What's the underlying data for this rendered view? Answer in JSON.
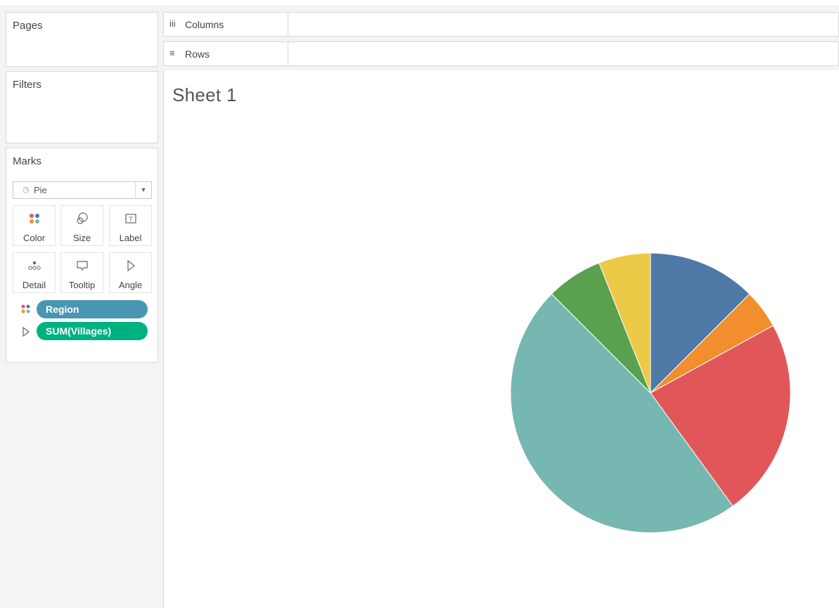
{
  "shelves": {
    "pages_label": "Pages",
    "filters_label": "Filters",
    "columns_label": "Columns",
    "rows_label": "Rows"
  },
  "marks": {
    "title": "Marks",
    "mark_type": "Pie",
    "buttons": [
      {
        "label": "Color",
        "icon": "color-dots-icon"
      },
      {
        "label": "Size",
        "icon": "size-icon"
      },
      {
        "label": "Label",
        "icon": "label-icon"
      },
      {
        "label": "Detail",
        "icon": "detail-dots-icon"
      },
      {
        "label": "Tooltip",
        "icon": "tooltip-icon"
      },
      {
        "label": "Angle",
        "icon": "angle-icon"
      }
    ],
    "pills": [
      {
        "label": "Region",
        "encoding": "color",
        "color": "#4996b2"
      },
      {
        "label": "SUM(Villages)",
        "encoding": "angle",
        "color": "#00b180"
      }
    ]
  },
  "view": {
    "sheet_title": "Sheet 1"
  },
  "chart_data": {
    "type": "pie",
    "title": "",
    "slices": [
      {
        "value": 12.5,
        "color": "#4e79a7"
      },
      {
        "value": 4.5,
        "color": "#f28e2b"
      },
      {
        "value": 23.0,
        "color": "#e15759"
      },
      {
        "value": 47.5,
        "color": "#76b7b2"
      },
      {
        "value": 6.5,
        "color": "#59a14f"
      },
      {
        "value": 6.0,
        "color": "#edc948"
      }
    ]
  }
}
